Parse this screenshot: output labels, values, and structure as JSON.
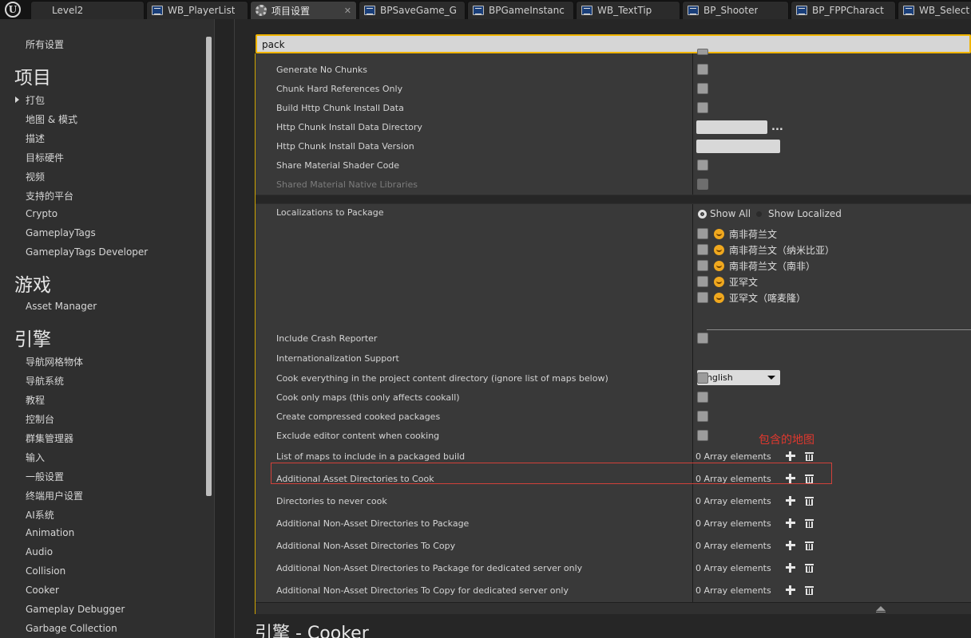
{
  "tabs": [
    {
      "label": "Level2",
      "icon": "level-icon",
      "active": false
    },
    {
      "label": "WB_PlayerList",
      "icon": "blueprint-icon",
      "active": false
    },
    {
      "label": "项目设置",
      "icon": "settings-gear-icon",
      "active": true
    },
    {
      "label": "BPSaveGame_G",
      "icon": "blueprint-icon",
      "active": false
    },
    {
      "label": "BPGameInstanc",
      "icon": "blueprint-icon",
      "active": false
    },
    {
      "label": "WB_TextTip",
      "icon": "blueprint-icon",
      "active": false
    },
    {
      "label": "BP_Shooter",
      "icon": "blueprint-icon",
      "active": false
    },
    {
      "label": "BP_FPPCharact",
      "icon": "blueprint-icon",
      "active": false
    },
    {
      "label": "WB_Select",
      "icon": "blueprint-icon",
      "active": false
    }
  ],
  "tab_close_glyph": "✕",
  "sidebar": {
    "all_settings": "所有设置",
    "sections": [
      {
        "title": "项目",
        "items": [
          "打包",
          "地图 & 模式",
          "描述",
          "目标硬件",
          "视频",
          "支持的平台",
          "Crypto",
          "GameplayTags",
          "GameplayTags Developer"
        ]
      },
      {
        "title": "游戏",
        "items": [
          "Asset Manager"
        ]
      },
      {
        "title": "引擎",
        "items": [
          "导航网格物体",
          "导航系统",
          "教程",
          "控制台",
          "群集管理器",
          "输入",
          "一般设置",
          "终端用户设置",
          "AI系统",
          "Animation",
          "Audio",
          "Collision",
          "Cooker",
          "Gameplay Debugger",
          "Garbage Collection"
        ]
      }
    ]
  },
  "search": {
    "value": "pack",
    "placeholder": ""
  },
  "settings": {
    "chunk_rows": [
      {
        "label": "Generate No Chunks"
      },
      {
        "label": "Chunk Hard References Only"
      },
      {
        "label": "Build Http Chunk Install Data"
      },
      {
        "label": "Http Chunk Install Data Directory"
      },
      {
        "label": "Http Chunk Install Data Version"
      },
      {
        "label": "Share Material Shader Code"
      },
      {
        "label": "Shared Material Native Libraries"
      }
    ],
    "ellipsis": "...",
    "localizations": {
      "label": "Localizations to Package",
      "show_all": "Show All",
      "show_localized": "Show Localized",
      "languages": [
        "南非荷兰文",
        "南非荷兰文（纳米比亚）",
        "南非荷兰文（南非）",
        "亚罕文",
        "亚罕文（喀麦隆）"
      ]
    },
    "lower_rows": [
      {
        "label": "Include Crash Reporter"
      },
      {
        "label": "Internationalization Support"
      },
      {
        "label": "Cook everything in the project content directory (ignore list of maps below)"
      },
      {
        "label": "Cook only maps (this only affects cookall)"
      },
      {
        "label": "Create compressed cooked packages"
      },
      {
        "label": "Exclude editor content when cooking"
      }
    ],
    "internationalization_value": "English",
    "annotation": "包含的地图",
    "array_rows": [
      {
        "label": "List of maps to include in a packaged build",
        "value": "0 Array elements"
      },
      {
        "label": "Additional Asset Directories to Cook",
        "value": "0 Array elements"
      },
      {
        "label": "Directories to never cook",
        "value": "0 Array elements"
      },
      {
        "label": "Additional Non-Asset Directories to Package",
        "value": "0 Array elements"
      },
      {
        "label": "Additional Non-Asset Directories To Copy",
        "value": "0 Array elements"
      },
      {
        "label": "Additional Non-Asset Directories to Package for dedicated server only",
        "value": "0 Array elements"
      },
      {
        "label": "Additional Non-Asset Directories To Copy for dedicated server only",
        "value": "0 Array elements"
      }
    ]
  },
  "next_section_title": "引擎 - Cooker",
  "colors": {
    "accent": "#f0b400",
    "annotation_red": "#e0382e",
    "panel": "#393939"
  }
}
